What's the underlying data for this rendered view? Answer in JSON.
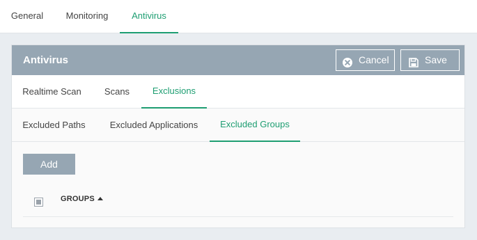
{
  "top_tabs": [
    "General",
    "Monitoring",
    "Antivirus"
  ],
  "top_active": "Antivirus",
  "panel": {
    "title": "Antivirus",
    "cancel_label": "Cancel",
    "save_label": "Save"
  },
  "sub_tabs": [
    "Realtime Scan",
    "Scans",
    "Exclusions"
  ],
  "exclusion_tabs": [
    "Excluded Paths",
    "Excluded Applications",
    "Excluded Groups"
  ],
  "add_label": "Add",
  "table": {
    "columns": [
      "GROUPS"
    ],
    "sort": "ascending"
  },
  "colors": {
    "accent": "#1e9e72",
    "header_bg": "#96a6b3"
  },
  "icons": [
    "cancel-circle-x-icon",
    "save-disk-icon",
    "sort-ascending-icon"
  ]
}
